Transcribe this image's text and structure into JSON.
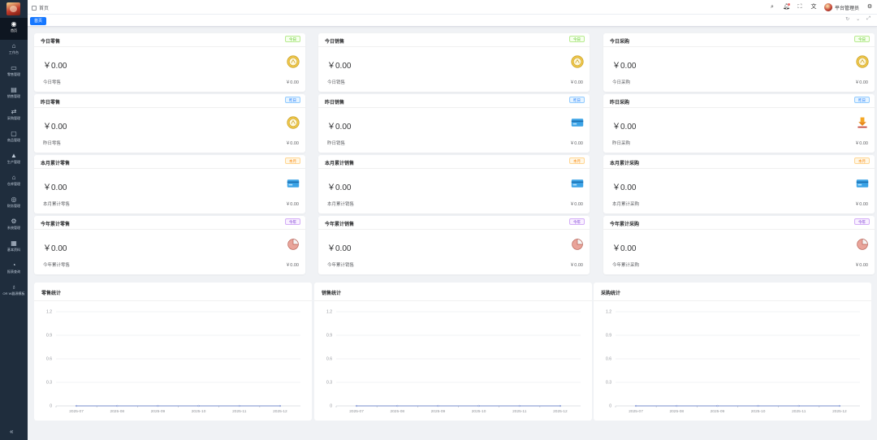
{
  "sidebar": {
    "items": [
      {
        "label": "首页",
        "icon": "dashboard-icon",
        "glyph": "◉"
      },
      {
        "label": "工作台",
        "icon": "home-icon",
        "glyph": "⌂"
      },
      {
        "label": "零售管理",
        "icon": "folder-icon",
        "glyph": "▭"
      },
      {
        "label": "销售管理",
        "icon": "table-icon",
        "glyph": "▤"
      },
      {
        "label": "采购管理",
        "icon": "swap-icon",
        "glyph": "⇄"
      },
      {
        "label": "商品管理",
        "icon": "bag-icon",
        "glyph": "▢"
      },
      {
        "label": "生产管理",
        "icon": "fire-icon",
        "glyph": "▲"
      },
      {
        "label": "仓库管理",
        "icon": "warehouse-icon",
        "glyph": "⌂"
      },
      {
        "label": "财务管理",
        "icon": "finance-icon",
        "glyph": "◎"
      },
      {
        "label": "系统管理",
        "icon": "gear-icon",
        "glyph": "⚙"
      },
      {
        "label": "基本资料",
        "icon": "grid-icon",
        "glyph": "▦"
      },
      {
        "label": "报表查询",
        "icon": "chart-icon",
        "glyph": "◔"
      },
      {
        "label": "OR W器源模板",
        "icon": "flask-icon",
        "glyph": "♁"
      }
    ],
    "collapse_glyph": "«"
  },
  "header": {
    "breadcrumb": "首页",
    "user_name": "平台管理员"
  },
  "tags": {
    "active": "首页"
  },
  "cards": [
    {
      "title": "今日零售",
      "badge": "今日",
      "badge_color": "green",
      "amount": "￥0.00",
      "foot_label": "今日零售",
      "foot_value": "￥0.00",
      "icon": "coin-icon"
    },
    {
      "title": "今日销售",
      "badge": "今日",
      "badge_color": "green",
      "amount": "￥0.00",
      "foot_label": "今日销售",
      "foot_value": "￥0.00",
      "icon": "coin-icon"
    },
    {
      "title": "今日采购",
      "badge": "今日",
      "badge_color": "green",
      "amount": "￥0.00",
      "foot_label": "今日采购",
      "foot_value": "￥0.00",
      "icon": "coin-icon"
    },
    {
      "title": "昨日零售",
      "badge": "昨日",
      "badge_color": "blue",
      "amount": "￥0.00",
      "foot_label": "昨日零售",
      "foot_value": "￥0.00",
      "icon": "coin-icon"
    },
    {
      "title": "昨日销售",
      "badge": "昨日",
      "badge_color": "blue",
      "amount": "￥0.00",
      "foot_label": "昨日销售",
      "foot_value": "￥0.00",
      "icon": "card-icon"
    },
    {
      "title": "昨日采购",
      "badge": "昨日",
      "badge_color": "blue",
      "amount": "￥0.00",
      "foot_label": "昨日采购",
      "foot_value": "￥0.00",
      "icon": "download-icon"
    },
    {
      "title": "本月累计零售",
      "badge": "本月",
      "badge_color": "orange",
      "amount": "￥0.00",
      "foot_label": "本月累计零售",
      "foot_value": "￥0.00",
      "icon": "card-icon"
    },
    {
      "title": "本月累计销售",
      "badge": "本月",
      "badge_color": "orange",
      "amount": "￥0.00",
      "foot_label": "本月累计销售",
      "foot_value": "￥0.00",
      "icon": "card-icon"
    },
    {
      "title": "本月累计采购",
      "badge": "本月",
      "badge_color": "orange",
      "amount": "￥0.00",
      "foot_label": "本月累计采购",
      "foot_value": "￥0.00",
      "icon": "card-icon"
    },
    {
      "title": "今年累计零售",
      "badge": "今年",
      "badge_color": "purple",
      "amount": "￥0.00",
      "foot_label": "今年累计零售",
      "foot_value": "￥0.00",
      "icon": "pie-icon"
    },
    {
      "title": "今年累计销售",
      "badge": "今年",
      "badge_color": "purple",
      "amount": "￥0.00",
      "foot_label": "今年累计销售",
      "foot_value": "￥0.00",
      "icon": "pie-icon"
    },
    {
      "title": "今年累计采购",
      "badge": "今年",
      "badge_color": "purple",
      "amount": "￥0.00",
      "foot_label": "今年累计采购",
      "foot_value": "￥0.00",
      "icon": "pie-icon"
    }
  ],
  "chart_data": [
    {
      "type": "line",
      "title": "零售统计",
      "categories": [
        "2025-07",
        "2025-08",
        "2025-09",
        "2025-10",
        "2025-11",
        "2025-12"
      ],
      "series": [
        {
          "values": [
            0,
            0,
            0,
            0,
            0,
            0
          ]
        }
      ],
      "yticks": [
        "1.2",
        "0.9",
        "0.6",
        "0.3",
        "0"
      ],
      "ylim": [
        0,
        1.2
      ],
      "grid": true
    },
    {
      "type": "line",
      "title": "销售统计",
      "categories": [
        "2025-07",
        "2025-08",
        "2025-09",
        "2025-10",
        "2025-11",
        "2025-12"
      ],
      "series": [
        {
          "values": [
            0,
            0,
            0,
            0,
            0,
            0
          ]
        }
      ],
      "yticks": [
        "1.2",
        "0.9",
        "0.6",
        "0.3",
        "0"
      ],
      "ylim": [
        0,
        1.2
      ],
      "grid": true
    },
    {
      "type": "line",
      "title": "采购统计",
      "categories": [
        "2025-07",
        "2025-08",
        "2025-09",
        "2025-10",
        "2025-11",
        "2025-12"
      ],
      "series": [
        {
          "values": [
            0,
            0,
            0,
            0,
            0,
            0
          ]
        }
      ],
      "yticks": [
        "1.2",
        "0.9",
        "0.6",
        "0.3",
        "0"
      ],
      "ylim": [
        0,
        1.2
      ],
      "grid": true
    }
  ],
  "colors": {
    "sidebar_bg": "#1f2d3d",
    "accent": "#1677ff"
  }
}
